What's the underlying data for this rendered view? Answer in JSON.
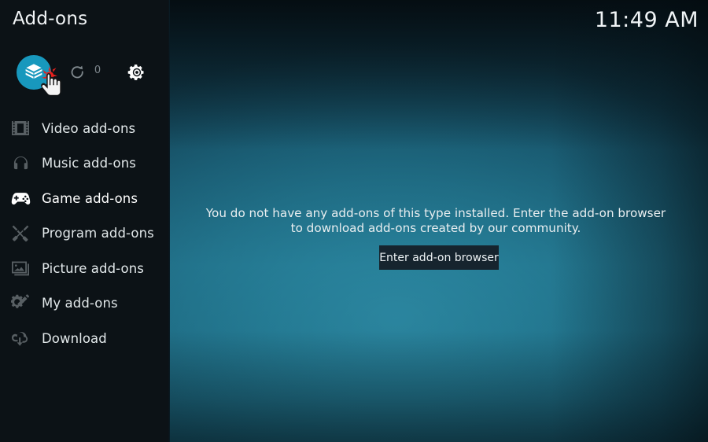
{
  "window": {
    "title": "Add-ons",
    "clock": "11:49 AM"
  },
  "toolbar": {
    "addon_browser_label": "Add-on browser",
    "addon_browser_icon": "package-box-icon",
    "refresh_label": "Check for updates",
    "refresh_icon": "refresh-icon",
    "update_count": "0",
    "settings_label": "Settings",
    "settings_icon": "gear-icon",
    "highlight_color": "#1898bd"
  },
  "sidebar": {
    "items": [
      {
        "label": "Video add-ons",
        "icon": "film-strip-icon",
        "active": false
      },
      {
        "label": "Music add-ons",
        "icon": "headphones-icon",
        "active": false
      },
      {
        "label": "Game add-ons",
        "icon": "gamepad-icon",
        "active": true
      },
      {
        "label": "Program add-ons",
        "icon": "tools-icon",
        "active": false
      },
      {
        "label": "Picture add-ons",
        "icon": "photo-icon",
        "active": false
      },
      {
        "label": "My add-ons",
        "icon": "gear-pencil-icon",
        "active": false
      },
      {
        "label": "Download",
        "icon": "cloud-download-icon",
        "active": false
      }
    ]
  },
  "main": {
    "empty_message": "You do not have any add-ons of this type installed. Enter the add-on browser to download add-ons created by our community.",
    "enter_browser_button": "Enter add-on browser"
  },
  "colors": {
    "sidebar_bg": "#0c1216",
    "accent": "#1898bd",
    "button_bg": "#16242e",
    "text": "#eef3f5",
    "click_marker": "#e8201c"
  }
}
